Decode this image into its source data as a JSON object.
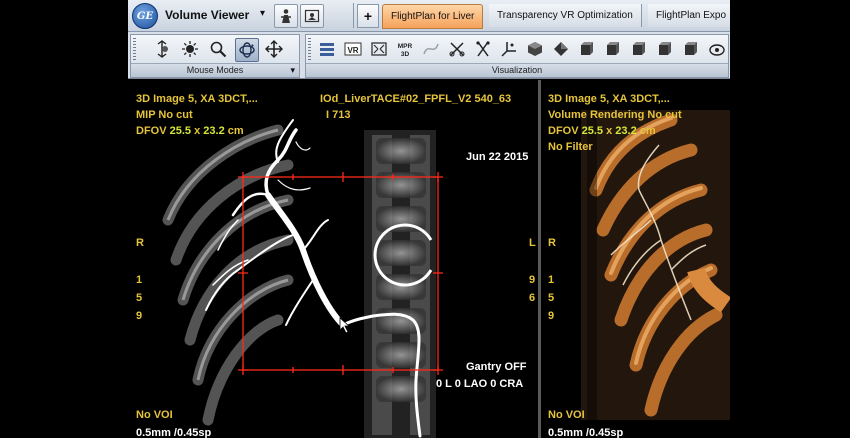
{
  "app": {
    "logo_text": "GE",
    "title": "Volume Viewer",
    "title_caret": "▾",
    "plus_label": "+",
    "tabs": [
      {
        "label": "FlightPlan for Liver",
        "active": true
      },
      {
        "label": "Transparency VR Optimization",
        "active": false
      },
      {
        "label": "FlightPlan Expo",
        "active": false
      }
    ]
  },
  "toolbar": {
    "mouse_modes_label": "Mouse Modes",
    "mouse_modes_caret": "▾",
    "visualization_label": "Visualization",
    "mouse_modes_icons": [
      "window-level-icon",
      "brightness-icon",
      "zoom-icon",
      "rotate-3d-icon",
      "pan-icon"
    ],
    "selected_mouse_mode": "rotate-3d-icon",
    "visualization_icons": [
      "layers-icon",
      "vr-icon",
      "fullscreen-icon",
      "mpr-3d-icon",
      "curve-icon",
      "scissors-icon",
      "cut-icon",
      "axis-icon",
      "cube-icon",
      "cube-solid-icon",
      "view-a-icon",
      "view-r-icon",
      "view-l-icon",
      "view-p-icon",
      "view-r2-icon",
      "camera-icon"
    ],
    "vr_label": "VR",
    "mpr_label": "MPR",
    "mpr_sub": "3D"
  },
  "main_view": {
    "info_line1": "3D Image 5, XA 3DCT,...",
    "info_line2": "MIP No cut",
    "dfov_prefix": "DFOV ",
    "dfov_w": "25.5",
    "dfov_x": " x ",
    "dfov_h": "23.2",
    "dfov_unit": " cm",
    "series_name": "IOd_LiverTACE#02_FPFL_V2 540_63",
    "image_number": "I 713",
    "date": "Jun 22 2015",
    "orient_left": "R",
    "orient_right": "L",
    "left_numbers": [
      "1",
      "5",
      "9"
    ],
    "right_numbers": [
      "9",
      "6"
    ],
    "gantry": "Gantry OFF",
    "angles": "0 L 0 LAO 0 CRA",
    "voi": "No VOI",
    "thickness": "0.5mm /0.45sp"
  },
  "vr_view": {
    "info_line1": "3D Image 5, XA 3DCT,...",
    "info_line2": "Volume Rendering No cut",
    "dfov_prefix": "DFOV ",
    "dfov_w": "25.5",
    "dfov_x": " x ",
    "dfov_h": "23.2",
    "dfov_unit": " cm",
    "filter": "No Filter",
    "orient_left": "R",
    "left_numbers": [
      "1",
      "5",
      "9"
    ],
    "voi": "No VOI",
    "thickness": "0.5mm /0.45sp"
  },
  "colors": {
    "overlay_text": "#e5c43a",
    "dfov_value": "#d6e63a",
    "crop_box": "#ff2a1a",
    "active_tab": "#f6a25a",
    "vr_bone": "#c9772f"
  }
}
